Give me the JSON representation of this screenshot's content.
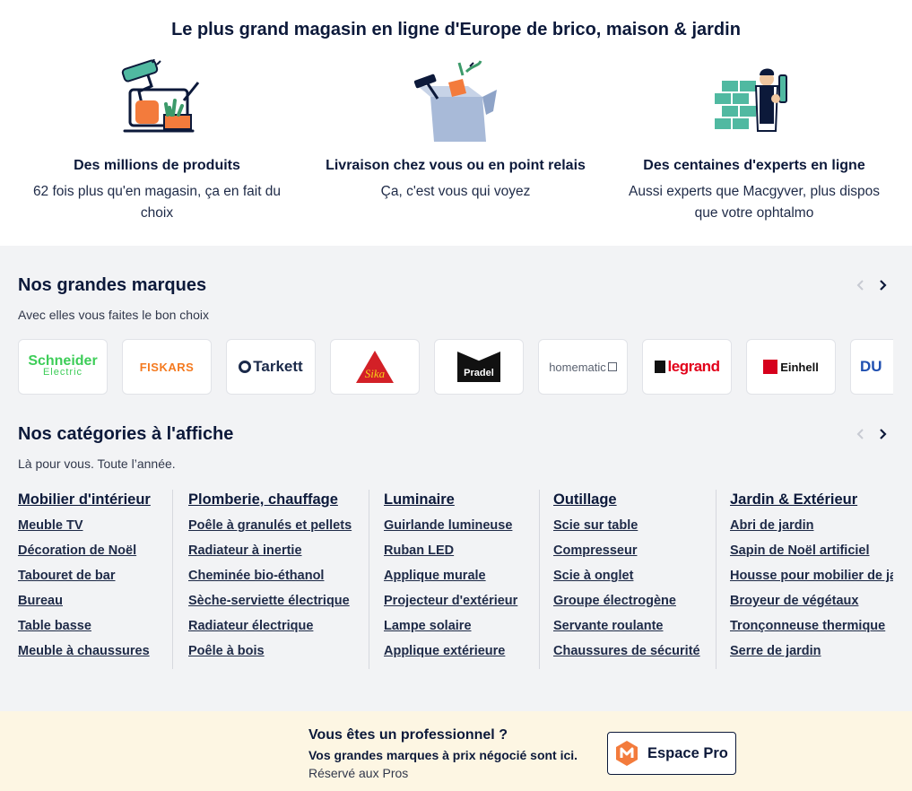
{
  "hero": {
    "title": "Le plus grand magasin en ligne d'Europe de brico, maison & jardin",
    "usps": [
      {
        "icon": "paint-roller-illustration-icon",
        "title": "Des millions de produits",
        "subtitle": "62 fois plus qu'en magasin, ça en fait du choix"
      },
      {
        "icon": "delivery-box-illustration-icon",
        "title": "Livraison chez vous ou en point relais",
        "subtitle": "Ça, c'est vous qui voyez"
      },
      {
        "icon": "expert-builder-illustration-icon",
        "title": "Des centaines d'experts en ligne",
        "subtitle": "Aussi experts que Macgyver, plus dispos que votre ophtalmo"
      }
    ]
  },
  "brands": {
    "title": "Nos grandes marques",
    "subtitle": "Avec elles vous faites le bon choix",
    "items": [
      {
        "name": "Schneider",
        "line2": "Electric",
        "color": "#3dcd58"
      },
      {
        "name": "FISKARS",
        "color": "#f47a20"
      },
      {
        "name": "Tarkett",
        "color": "#1b2a4a"
      },
      {
        "name": "Sika",
        "color": "#d32027"
      },
      {
        "name": "Pradel",
        "color": "#111111"
      },
      {
        "name": "homematic",
        "color": "#5a6270"
      },
      {
        "name": "legrand",
        "color": "#e2001a"
      },
      {
        "name": "Einhell",
        "color": "#d6001c"
      },
      {
        "name": "DU",
        "color": "#1f4fb0"
      }
    ]
  },
  "categories": {
    "title": "Nos catégories à l'affiche",
    "subtitle": "Là pour vous. Toute l’année.",
    "columns": [
      {
        "heading": "Mobilier d'intérieur",
        "links": [
          "Meuble TV",
          "Décoration de Noël",
          "Tabouret de bar",
          "Bureau",
          "Table basse",
          "Meuble à chaussures"
        ]
      },
      {
        "heading": "Plomberie, chauffage",
        "links": [
          "Poêle à granulés et pellets",
          "Radiateur à inertie",
          "Cheminée bio-éthanol",
          "Sèche-serviette électrique",
          "Radiateur électrique",
          "Poêle à bois"
        ]
      },
      {
        "heading": "Luminaire",
        "links": [
          "Guirlande lumineuse",
          "Ruban LED",
          "Applique murale",
          "Projecteur d'extérieur",
          "Lampe solaire",
          "Applique extérieure"
        ]
      },
      {
        "heading": "Outillage",
        "links": [
          "Scie sur table",
          "Compresseur",
          "Scie à onglet",
          "Groupe électrogène",
          "Servante roulante",
          "Chaussures de sécurité"
        ]
      },
      {
        "heading": "Jardin & Extérieur",
        "links": [
          "Abri de jardin",
          "Sapin de Noël artificiel",
          "Housse pour mobilier de jardin",
          "Broyeur de végétaux",
          "Tronçonneuse thermique",
          "Serre de jardin"
        ]
      }
    ]
  },
  "pro": {
    "title": "Vous êtes un professionnel ?",
    "subtitle": "Vos grandes marques à prix négocié sont ici.",
    "note": "Réservé aux Pros",
    "button_label": "Espace Pro",
    "logo_letter": "M"
  },
  "colors": {
    "navy": "#0c193a",
    "orange": "#f37b3c",
    "teal": "#50b9a1",
    "pro_bg": "#fdf6e3",
    "gray_bg": "#f2f3f5"
  }
}
